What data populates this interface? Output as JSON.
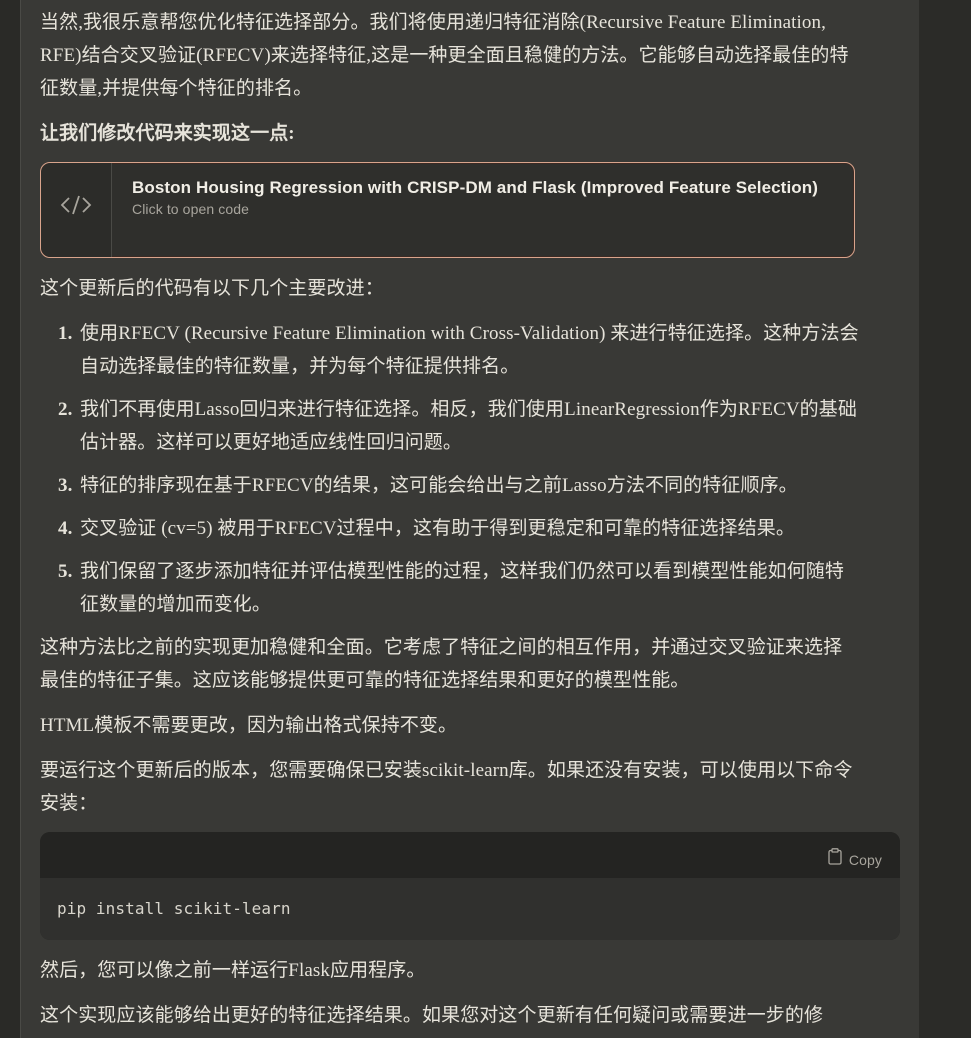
{
  "message": {
    "intro": "当然,我很乐意帮您优化特征选择部分。我们将使用递归特征消除(Recursive Feature Elimination, RFE)结合交叉验证(RFECV)来选择特征,这是一种更全面且稳健的方法。它能够自动选择最佳的特征数量,并提供每个特征的排名。",
    "lead_in": "让我们修改代码来实现这一点:",
    "artifact": {
      "icon": "code-icon",
      "title": "Boston Housing Regression with CRISP-DM and Flask (Improved Feature Selection)",
      "subtitle": "Click to open code",
      "border_color": "#d9a48c"
    },
    "list_intro": "这个更新后的代码有以下几个主要改进：",
    "improvements": [
      {
        "num": "1.",
        "text": "使用RFECV (Recursive Feature Elimination with Cross-Validation) 来进行特征选择。这种方法会自动选择最佳的特征数量，并为每个特征提供排名。"
      },
      {
        "num": "2.",
        "text": "我们不再使用Lasso回归来进行特征选择。相反，我们使用LinearRegression作为RFECV的基础估计器。这样可以更好地适应线性回归问题。"
      },
      {
        "num": "3.",
        "text": "特征的排序现在基于RFECV的结果，这可能会给出与之前Lasso方法不同的特征顺序。"
      },
      {
        "num": "4.",
        "text": "交叉验证 (cv=5) 被用于RFECV过程中，这有助于得到更稳定和可靠的特征选择结果。"
      },
      {
        "num": "5.",
        "text": "我们保留了逐步添加特征并评估模型性能的过程，这样我们仍然可以看到模型性能如何随特征数量的增加而变化。"
      }
    ],
    "summary": "这种方法比之前的实现更加稳健和全面。它考虑了特征之间的相互作用，并通过交叉验证来选择最佳的特征子集。这应该能够提供更可靠的特征选择结果和更好的模型性能。",
    "template_note": "HTML模板不需要更改，因为输出格式保持不变。",
    "install_note": "要运行这个更新后的版本，您需要确保已安装scikit-learn库。如果还没有安装，可以使用以下命令安装：",
    "code": {
      "copy_label": "Copy",
      "copy_icon": "clipboard-icon",
      "command": "pip install scikit-learn"
    },
    "after_code": "然后，您可以像之前一样运行Flask应用程序。",
    "closing": "这个实现应该能够给出更好的特征选择结果。如果您对这个更新有任何疑问或需要进一步的修"
  }
}
